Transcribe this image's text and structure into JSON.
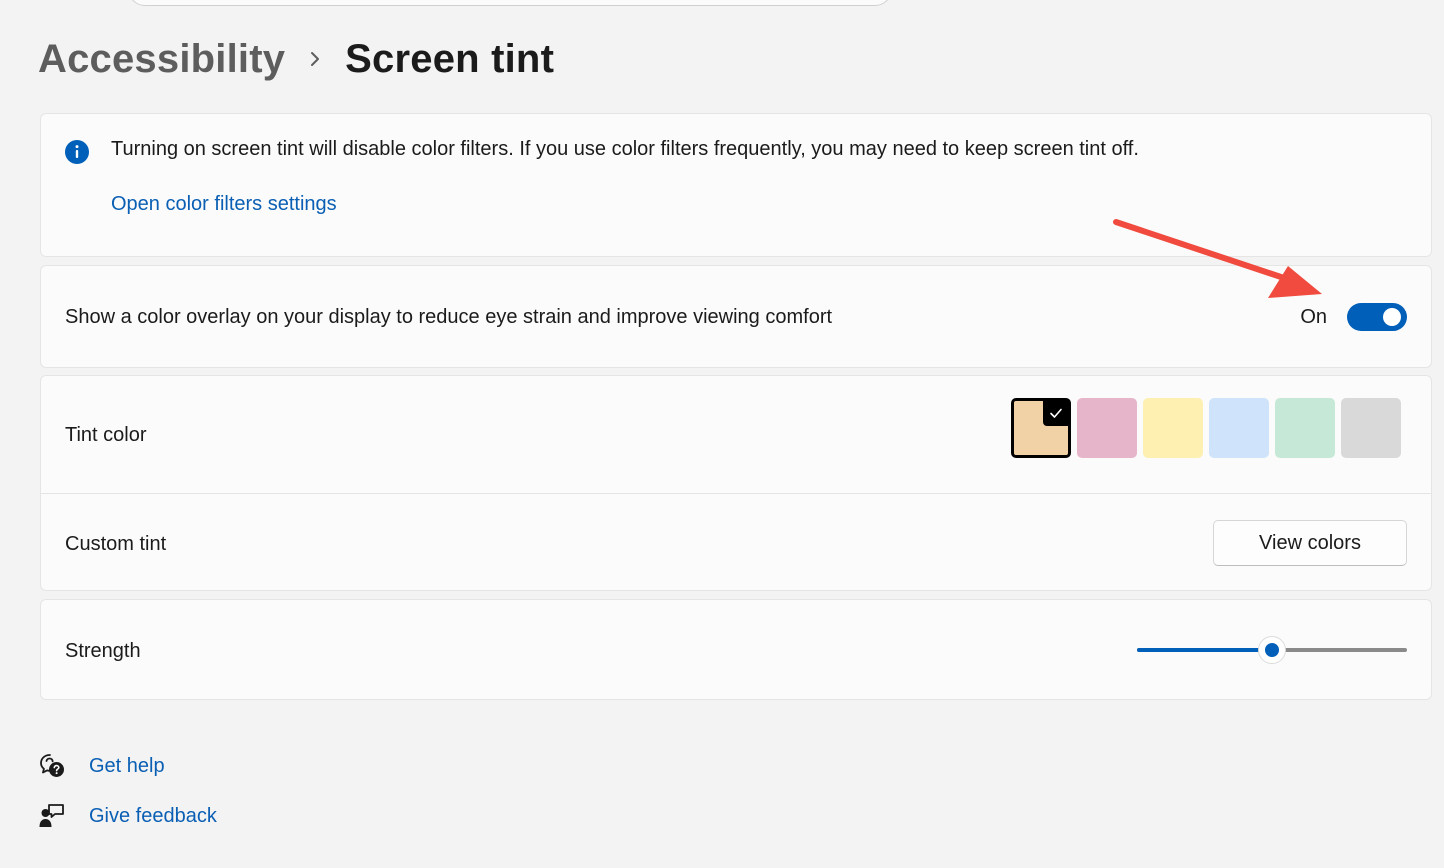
{
  "breadcrumb": {
    "parent": "Accessibility",
    "current": "Screen tint"
  },
  "info": {
    "icon": "info-icon",
    "message": "Turning on screen tint will disable color filters. If you use color filters frequently, you may need to keep screen tint off.",
    "link_label": "Open color filters settings"
  },
  "overlay": {
    "description": "Show a color overlay on your display to reduce eye strain and improve viewing comfort",
    "toggle_state_label": "On",
    "toggle_on": true,
    "accent": "#005fb8"
  },
  "tint": {
    "label": "Tint color",
    "selected_index": 0,
    "swatches": [
      "#f1d2a6",
      "#e6b5c9",
      "#fdf0b1",
      "#cfe4fb",
      "#c6e8d6",
      "#d9d9d9"
    ]
  },
  "custom_tint": {
    "label": "Custom tint",
    "button_label": "View colors"
  },
  "strength": {
    "label": "Strength",
    "value_fraction": 0.5
  },
  "footer": {
    "get_help": "Get help",
    "give_feedback": "Give feedback"
  },
  "annotation": {
    "color": "#f04b3e"
  }
}
